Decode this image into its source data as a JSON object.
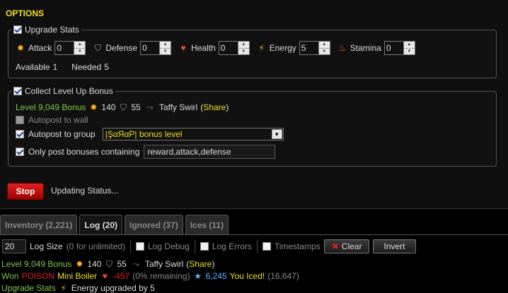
{
  "options": {
    "title": "OPTIONS",
    "upgrade": {
      "legend": "Upgrade Stats",
      "stats": [
        {
          "label": "Attack",
          "value": "0",
          "icon": "attack-icon"
        },
        {
          "label": "Defense",
          "value": "0",
          "icon": "defense-icon"
        },
        {
          "label": "Health",
          "value": "0",
          "icon": "health-icon"
        },
        {
          "label": "Energy",
          "value": "5",
          "icon": "energy-icon"
        },
        {
          "label": "Stamina",
          "value": "0",
          "icon": "stamina-icon"
        }
      ],
      "available_label": "Available",
      "available_value": "1",
      "needed_label": "Needed",
      "needed_value": "5"
    },
    "bonus": {
      "legend": "Collect Level Up Bonus",
      "summary": {
        "level": "Level 9,049 Bonus",
        "attack": "140",
        "defense": "55",
        "name": "Taffy Swirl",
        "share": "Share"
      },
      "autopost_wall": "Autopost to wall",
      "autopost_group": "Autopost to group",
      "group_selected": "|ŞαЯαР| bonus level",
      "only_post": "Only post bonuses containing",
      "keywords": "reward,attack,defense"
    },
    "stop_label": "Stop",
    "status": "Updating Status..."
  },
  "tabs": [
    {
      "label": "Inventory (2,221)",
      "active": false
    },
    {
      "label": "Log (20)",
      "active": true
    },
    {
      "label": "Ignored (37)",
      "active": false
    },
    {
      "label": "Ices (11)",
      "active": false
    }
  ],
  "logbar": {
    "size_value": "20",
    "size_label": "Log Size",
    "size_hint": "(0 for unlimited)",
    "debug": "Log Debug",
    "errors": "Log Errors",
    "timestamps": "Timestamps",
    "clear": "Clear",
    "invert": "Invert"
  },
  "log": {
    "line1": {
      "level": "Level 9,049 Bonus",
      "attack": "140",
      "defense": "55",
      "name": "Taffy Swirl",
      "share": "Share"
    },
    "line2": {
      "won": "Won",
      "poison": "POISON",
      "item": "Mini Boiler",
      "health": "-457",
      "remaining": "(0% remaining)",
      "iced_count": "6,245",
      "iced": "You Iced!",
      "total": "(16,647)"
    },
    "line3": {
      "upgrade": "Upgrade Stats",
      "text": "Energy upgraded by 5"
    }
  },
  "colors": {
    "accent": "#f0e020",
    "green": "#7ec84a",
    "stop": "#d01818",
    "link": "#f0e020"
  }
}
